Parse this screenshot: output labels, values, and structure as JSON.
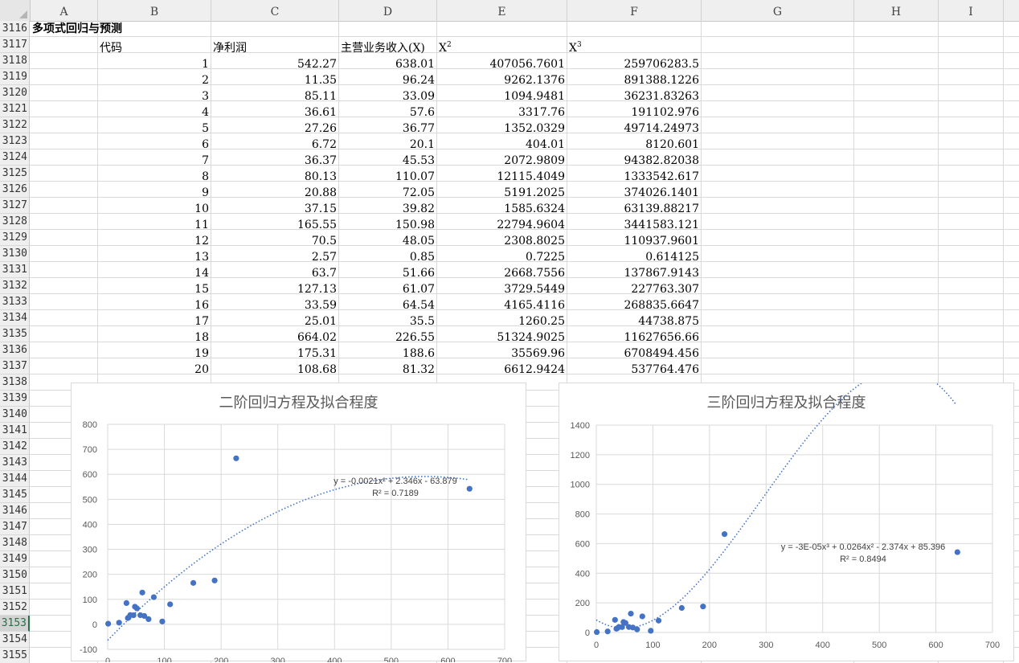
{
  "columns": [
    {
      "label": "A"
    },
    {
      "label": "B"
    },
    {
      "label": "C"
    },
    {
      "label": "D"
    },
    {
      "label": "E"
    },
    {
      "label": "F"
    },
    {
      "label": "G"
    },
    {
      "label": "H"
    },
    {
      "label": "I"
    }
  ],
  "rows": [
    "3116",
    "3117",
    "3118",
    "3119",
    "3120",
    "3121",
    "3122",
    "3123",
    "3124",
    "3125",
    "3126",
    "3127",
    "3128",
    "3129",
    "3130",
    "3131",
    "3132",
    "3133",
    "3134",
    "3135",
    "3136",
    "3137",
    "3138",
    "3139",
    "3140",
    "3141",
    "3142",
    "3143",
    "3144",
    "3145",
    "3146",
    "3147",
    "3148",
    "3149",
    "3150",
    "3151",
    "3152",
    "3153",
    "3154",
    "3155"
  ],
  "active_row": "3153",
  "sheet": {
    "title": "多项式回归与预测",
    "headers": {
      "code": "代码",
      "net_profit": "净利润",
      "revenue": "主营业务收入(X)",
      "x2_base": "X",
      "x2_exp": "2",
      "x3_base": "X",
      "x3_exp": "3"
    },
    "data": [
      {
        "code": "1",
        "profit": "542.27",
        "revenue": "638.01",
        "x2": "407056.7601",
        "x3": "259706283.5"
      },
      {
        "code": "2",
        "profit": "11.35",
        "revenue": "96.24",
        "x2": "9262.1376",
        "x3": "891388.1226"
      },
      {
        "code": "3",
        "profit": "85.11",
        "revenue": "33.09",
        "x2": "1094.9481",
        "x3": "36231.83263"
      },
      {
        "code": "4",
        "profit": "36.61",
        "revenue": "57.6",
        "x2": "3317.76",
        "x3": "191102.976"
      },
      {
        "code": "5",
        "profit": "27.26",
        "revenue": "36.77",
        "x2": "1352.0329",
        "x3": "49714.24973"
      },
      {
        "code": "6",
        "profit": "6.72",
        "revenue": "20.1",
        "x2": "404.01",
        "x3": "8120.601"
      },
      {
        "code": "7",
        "profit": "36.37",
        "revenue": "45.53",
        "x2": "2072.9809",
        "x3": "94382.82038"
      },
      {
        "code": "8",
        "profit": "80.13",
        "revenue": "110.07",
        "x2": "12115.4049",
        "x3": "1333542.617"
      },
      {
        "code": "9",
        "profit": "20.88",
        "revenue": "72.05",
        "x2": "5191.2025",
        "x3": "374026.1401"
      },
      {
        "code": "10",
        "profit": "37.15",
        "revenue": "39.82",
        "x2": "1585.6324",
        "x3": "63139.88217"
      },
      {
        "code": "11",
        "profit": "165.55",
        "revenue": "150.98",
        "x2": "22794.9604",
        "x3": "3441583.121"
      },
      {
        "code": "12",
        "profit": "70.5",
        "revenue": "48.05",
        "x2": "2308.8025",
        "x3": "110937.9601"
      },
      {
        "code": "13",
        "profit": "2.57",
        "revenue": "0.85",
        "x2": "0.7225",
        "x3": "0.614125"
      },
      {
        "code": "14",
        "profit": "63.7",
        "revenue": "51.66",
        "x2": "2668.7556",
        "x3": "137867.9143"
      },
      {
        "code": "15",
        "profit": "127.13",
        "revenue": "61.07",
        "x2": "3729.5449",
        "x3": "227763.307"
      },
      {
        "code": "16",
        "profit": "33.59",
        "revenue": "64.54",
        "x2": "4165.4116",
        "x3": "268835.6647"
      },
      {
        "code": "17",
        "profit": "25.01",
        "revenue": "35.5",
        "x2": "1260.25",
        "x3": "44738.875"
      },
      {
        "code": "18",
        "profit": "664.02",
        "revenue": "226.55",
        "x2": "51324.9025",
        "x3": "11627656.66"
      },
      {
        "code": "19",
        "profit": "175.31",
        "revenue": "188.6",
        "x2": "35569.96",
        "x3": "6708494.456"
      },
      {
        "code": "20",
        "profit": "108.68",
        "revenue": "81.32",
        "x2": "6612.9424",
        "x3": "537764.476"
      }
    ]
  },
  "colors": {
    "marker": "#4472c4",
    "trend": "#4472c4",
    "grid": "#d9d9d9",
    "axis_text": "#595959"
  },
  "chart_data": [
    {
      "type": "scatter",
      "title": "二阶回归方程及拟合程度",
      "xlim": [
        0,
        700
      ],
      "ylim": [
        -100,
        800
      ],
      "xticks": [
        "0",
        "100",
        "200",
        "300",
        "400",
        "500",
        "600",
        "700"
      ],
      "yticks": [
        "-100",
        "0",
        "100",
        "200",
        "300",
        "400",
        "500",
        "600",
        "700",
        "800"
      ],
      "grid": true,
      "points": [
        [
          638.01,
          542.27
        ],
        [
          96.24,
          11.35
        ],
        [
          33.09,
          85.11
        ],
        [
          57.6,
          36.61
        ],
        [
          36.77,
          27.26
        ],
        [
          20.1,
          6.72
        ],
        [
          45.53,
          36.37
        ],
        [
          110.07,
          80.13
        ],
        [
          72.05,
          20.88
        ],
        [
          39.82,
          37.15
        ],
        [
          150.98,
          165.55
        ],
        [
          48.05,
          70.5
        ],
        [
          0.85,
          2.57
        ],
        [
          51.66,
          63.7
        ],
        [
          61.07,
          127.13
        ],
        [
          64.54,
          33.59
        ],
        [
          35.5,
          25.01
        ],
        [
          226.55,
          664.02
        ],
        [
          188.6,
          175.31
        ],
        [
          81.32,
          108.68
        ]
      ],
      "trendline": {
        "type": "poly2",
        "coefficients": [
          -0.0021,
          2.346,
          -63.879
        ]
      },
      "equation": "y = -0.0021x² + 2.346x - 63.879",
      "r2": "R² = 0.7189"
    },
    {
      "type": "scatter",
      "title": "三阶回归方程及拟合程度",
      "xlim": [
        0,
        700
      ],
      "ylim": [
        0,
        1400
      ],
      "xticks": [
        "0",
        "100",
        "200",
        "300",
        "400",
        "500",
        "600",
        "700"
      ],
      "yticks": [
        "0",
        "200",
        "400",
        "600",
        "800",
        "1000",
        "1200",
        "1400"
      ],
      "grid": true,
      "points": [
        [
          638.01,
          542.27
        ],
        [
          96.24,
          11.35
        ],
        [
          33.09,
          85.11
        ],
        [
          57.6,
          36.61
        ],
        [
          36.77,
          27.26
        ],
        [
          20.1,
          6.72
        ],
        [
          45.53,
          36.37
        ],
        [
          110.07,
          80.13
        ],
        [
          72.05,
          20.88
        ],
        [
          39.82,
          37.15
        ],
        [
          150.98,
          165.55
        ],
        [
          48.05,
          70.5
        ],
        [
          0.85,
          2.57
        ],
        [
          51.66,
          63.7
        ],
        [
          61.07,
          127.13
        ],
        [
          64.54,
          33.59
        ],
        [
          35.5,
          25.01
        ],
        [
          226.55,
          664.02
        ],
        [
          188.6,
          175.31
        ],
        [
          81.32,
          108.68
        ]
      ],
      "trendline": {
        "type": "poly3",
        "coefficients": [
          -3e-05,
          0.0264,
          -2.374,
          85.396
        ]
      },
      "equation": "y = -3E-05x³ + 0.0264x² - 2.374x + 85.396",
      "r2": "R² = 0.8494"
    }
  ]
}
